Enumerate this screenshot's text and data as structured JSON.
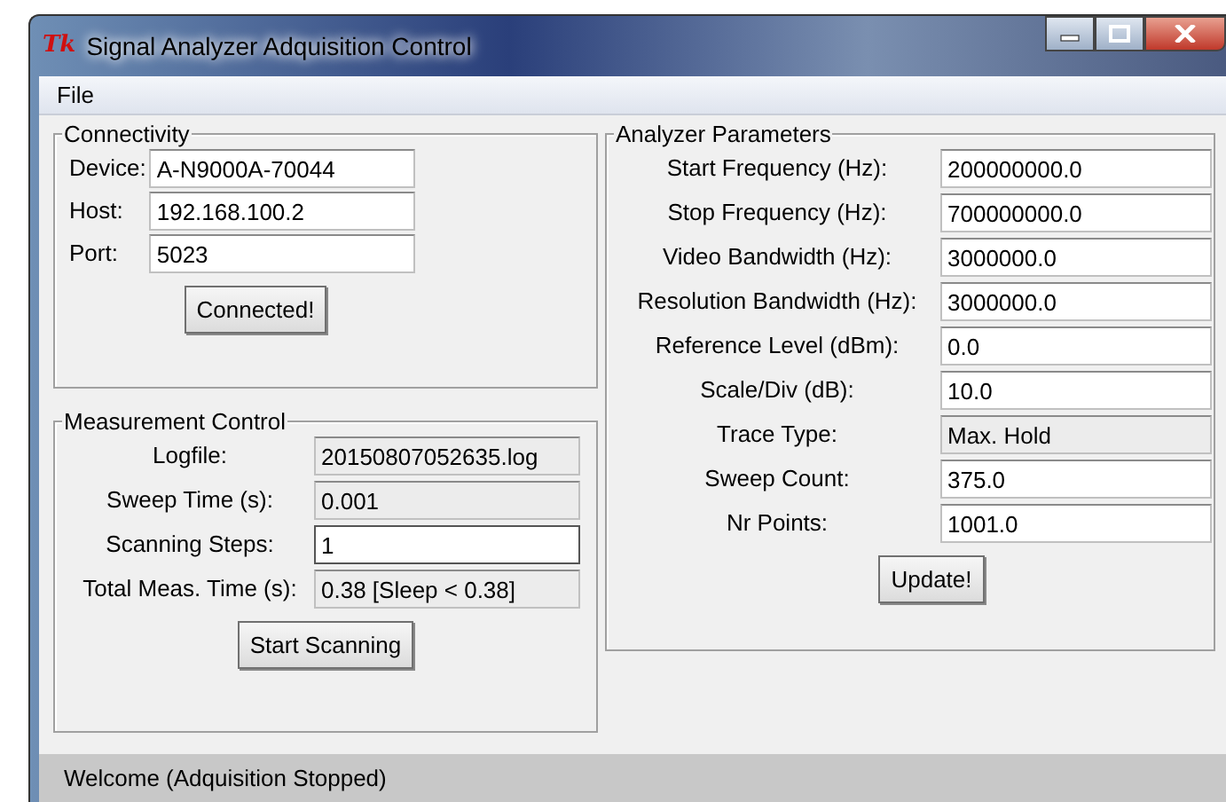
{
  "window": {
    "title": "Signal Analyzer Adquisition Control",
    "app_icon": "Tk"
  },
  "menu": [
    {
      "label": "File"
    }
  ],
  "connectivity": {
    "title": "Connectivity",
    "fields": [
      {
        "label": "Device:",
        "value": "A-N9000A-70044",
        "readonly": false
      },
      {
        "label": "Host:",
        "value": "192.168.100.2",
        "readonly": false
      },
      {
        "label": "Port:",
        "value": "5023",
        "readonly": false
      }
    ],
    "button": "Connected!"
  },
  "measurement": {
    "title": "Measurement Control",
    "fields": [
      {
        "label": "Logfile:",
        "value": "20150807052635.log",
        "readonly": true,
        "focused": false
      },
      {
        "label": "Sweep Time (s):",
        "value": "0.001",
        "readonly": true,
        "focused": false
      },
      {
        "label": "Scanning Steps:",
        "value": "1",
        "readonly": false,
        "focused": true
      },
      {
        "label": "Total Meas. Time (s):",
        "value": "0.38 [Sleep < 0.38]",
        "readonly": true,
        "focused": false
      }
    ],
    "button": "Start Scanning"
  },
  "analyzer": {
    "title": "Analyzer Parameters",
    "fields": [
      {
        "label": "Start Frequency (Hz):",
        "value": "200000000.0",
        "readonly": false
      },
      {
        "label": "Stop Frequency (Hz):",
        "value": "700000000.0",
        "readonly": false
      },
      {
        "label": "Video Bandwidth (Hz):",
        "value": "3000000.0",
        "readonly": false
      },
      {
        "label": "Resolution Bandwidth (Hz):",
        "value": "3000000.0",
        "readonly": false
      },
      {
        "label": "Reference Level (dBm):",
        "value": "0.0",
        "readonly": false
      },
      {
        "label": "Scale/Div (dB):",
        "value": "10.0",
        "readonly": false
      },
      {
        "label": "Trace Type:",
        "value": "Max. Hold",
        "readonly": true
      },
      {
        "label": "Sweep Count:",
        "value": "375.0",
        "readonly": false
      },
      {
        "label": "Nr Points:",
        "value": "1001.0",
        "readonly": false
      }
    ],
    "button": "Update!"
  },
  "status_bar": "Welcome (Adquisition Stopped)"
}
